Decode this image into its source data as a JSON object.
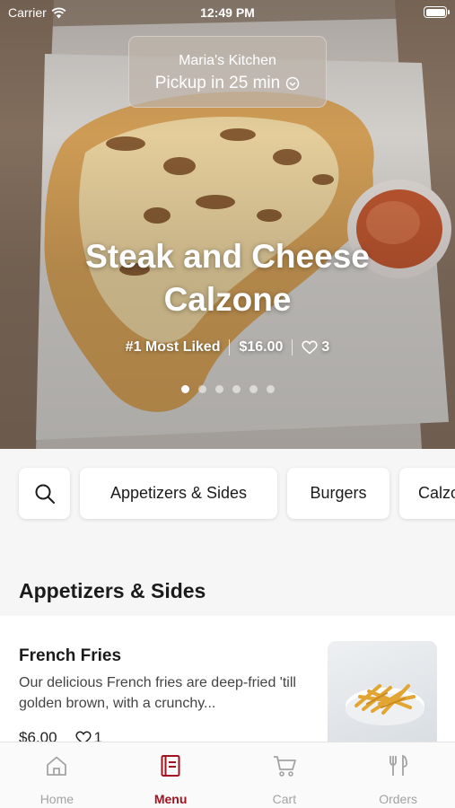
{
  "status_bar": {
    "carrier": "Carrier",
    "time": "12:49 PM"
  },
  "store": {
    "name": "Maria's Kitchen",
    "pickup": "Pickup in 25 min"
  },
  "featured": {
    "title": "Steak and Cheese Calzone",
    "badge": "#1 Most Liked",
    "price": "$16.00",
    "likes": "3",
    "carousel_pages": 6,
    "carousel_active": 1
  },
  "categories": [
    "Appetizers & Sides",
    "Burgers",
    "Calzones"
  ],
  "section_title": "Appetizers & Sides",
  "items": [
    {
      "name": "French Fries",
      "description": "Our delicious French fries are deep-fried 'till golden brown, with a crunchy...",
      "price": "$6.00",
      "likes": "1"
    }
  ],
  "tabs": [
    {
      "label": "Home",
      "icon": "home-icon"
    },
    {
      "label": "Menu",
      "icon": "menu-icon"
    },
    {
      "label": "Cart",
      "icon": "cart-icon"
    },
    {
      "label": "Orders",
      "icon": "orders-icon"
    }
  ],
  "colors": {
    "accent": "#a2121f",
    "inactive_tab": "#a3a3a3"
  }
}
